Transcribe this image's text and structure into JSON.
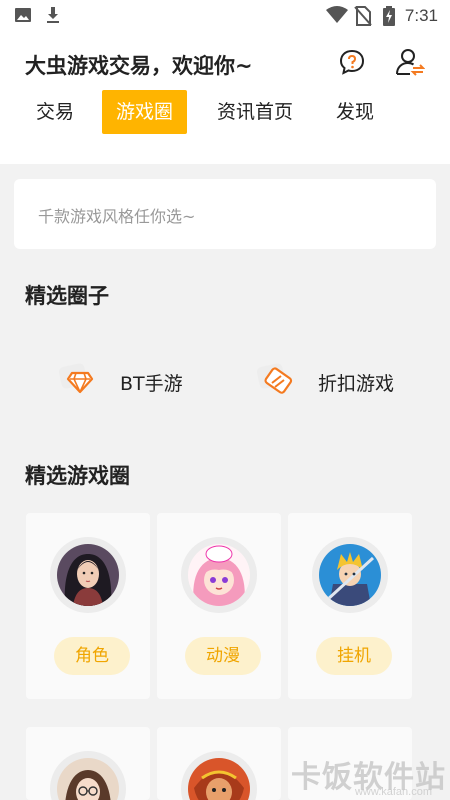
{
  "status_bar": {
    "time": "7:31",
    "icons": [
      "image-icon",
      "download-icon",
      "wifi-icon",
      "no-sim-icon",
      "battery-charging-icon"
    ]
  },
  "header": {
    "title": "大虫游戏交易，欢迎你~",
    "icons": [
      "help-chat-icon",
      "user-exchange-icon"
    ]
  },
  "tabs": [
    {
      "label": "交易",
      "active": false
    },
    {
      "label": "游戏圈",
      "active": true
    },
    {
      "label": "资讯首页",
      "active": false
    },
    {
      "label": "发现",
      "active": false
    }
  ],
  "search": {
    "placeholder": "千款游戏风格任你选~"
  },
  "featured_circles": {
    "title": "精选圈子",
    "items": [
      {
        "label": "BT手游",
        "icon": "diamond-icon"
      },
      {
        "label": "折扣游戏",
        "icon": "coupon-icon"
      }
    ]
  },
  "featured_games": {
    "title": "精选游戏圈",
    "cards": [
      {
        "tag": "角色",
        "avatar": "female-warrior-avatar"
      },
      {
        "tag": "动漫",
        "avatar": "pink-hair-anime-avatar"
      },
      {
        "tag": "挂机",
        "avatar": "blonde-knight-avatar"
      },
      {
        "tag": "",
        "avatar": "glasses-girl-avatar"
      },
      {
        "tag": "",
        "avatar": "monkey-king-avatar"
      }
    ]
  },
  "watermark": {
    "text": "卡饭软件站",
    "sub": "www.kafan.com"
  },
  "colors": {
    "accent": "#ffb400",
    "pill_bg": "#fdf1cc",
    "pill_text": "#f0a500",
    "icon_orange": "#f47a20"
  }
}
